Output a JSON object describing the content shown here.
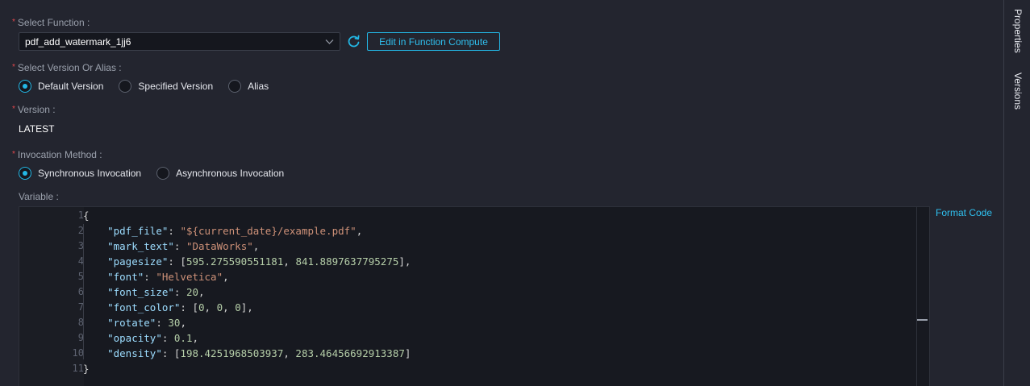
{
  "form": {
    "select_function_label": "Select Function :",
    "selected_function": "pdf_add_watermark_1jj6",
    "edit_button_label": "Edit in Function Compute",
    "version_or_alias_label": "Select Version Or Alias :",
    "version_options": [
      {
        "label": "Default Version",
        "checked": true
      },
      {
        "label": "Specified Version",
        "checked": false
      },
      {
        "label": "Alias",
        "checked": false
      }
    ],
    "version_label": "Version :",
    "version_value": "LATEST",
    "invocation_label": "Invocation Method :",
    "invocation_options": [
      {
        "label": "Synchronous Invocation",
        "checked": true
      },
      {
        "label": "Asynchronous Invocation",
        "checked": false
      }
    ],
    "variable_label": "Variable :",
    "format_code_label": "Format Code"
  },
  "editor": {
    "line_numbers": [
      "1",
      "2",
      "3",
      "4",
      "5",
      "6",
      "7",
      "8",
      "9",
      "10",
      "11"
    ],
    "lines": [
      [
        [
          "p",
          "{"
        ]
      ],
      [
        [
          "p",
          "    "
        ],
        [
          "k",
          "\"pdf_file\""
        ],
        [
          "p",
          ": "
        ],
        [
          "s",
          "\"${current_date}/example.pdf\""
        ],
        [
          "p",
          ","
        ]
      ],
      [
        [
          "p",
          "    "
        ],
        [
          "k",
          "\"mark_text\""
        ],
        [
          "p",
          ": "
        ],
        [
          "s",
          "\"DataWorks\""
        ],
        [
          "p",
          ","
        ]
      ],
      [
        [
          "p",
          "    "
        ],
        [
          "k",
          "\"pagesize\""
        ],
        [
          "p",
          ": ["
        ],
        [
          "n",
          "595.275590551181"
        ],
        [
          "p",
          ", "
        ],
        [
          "n",
          "841.8897637795275"
        ],
        [
          "p",
          "],"
        ]
      ],
      [
        [
          "p",
          "    "
        ],
        [
          "k",
          "\"font\""
        ],
        [
          "p",
          ": "
        ],
        [
          "s",
          "\"Helvetica\""
        ],
        [
          "p",
          ","
        ]
      ],
      [
        [
          "p",
          "    "
        ],
        [
          "k",
          "\"font_size\""
        ],
        [
          "p",
          ": "
        ],
        [
          "n",
          "20"
        ],
        [
          "p",
          ","
        ]
      ],
      [
        [
          "p",
          "    "
        ],
        [
          "k",
          "\"font_color\""
        ],
        [
          "p",
          ": ["
        ],
        [
          "n",
          "0"
        ],
        [
          "p",
          ", "
        ],
        [
          "n",
          "0"
        ],
        [
          "p",
          ", "
        ],
        [
          "n",
          "0"
        ],
        [
          "p",
          "],"
        ]
      ],
      [
        [
          "p",
          "    "
        ],
        [
          "k",
          "\"rotate\""
        ],
        [
          "p",
          ": "
        ],
        [
          "n",
          "30"
        ],
        [
          "p",
          ","
        ]
      ],
      [
        [
          "p",
          "    "
        ],
        [
          "k",
          "\"opacity\""
        ],
        [
          "p",
          ": "
        ],
        [
          "n",
          "0.1"
        ],
        [
          "p",
          ","
        ]
      ],
      [
        [
          "p",
          "    "
        ],
        [
          "k",
          "\"density\""
        ],
        [
          "p",
          ": ["
        ],
        [
          "n",
          "198.4251968503937"
        ],
        [
          "p",
          ", "
        ],
        [
          "n",
          "283.46456692913387"
        ],
        [
          "p",
          "]"
        ]
      ],
      [
        [
          "p",
          "}"
        ]
      ]
    ]
  },
  "side_panel": {
    "tabs": [
      "Properties",
      "Versions"
    ]
  },
  "colors": {
    "accent": "#23b7e5",
    "required": "#e5484d",
    "background": "#23252f",
    "editor_bg": "#171920"
  },
  "icons": {
    "dropdown": "chevron-down-icon",
    "refresh": "refresh-icon"
  }
}
